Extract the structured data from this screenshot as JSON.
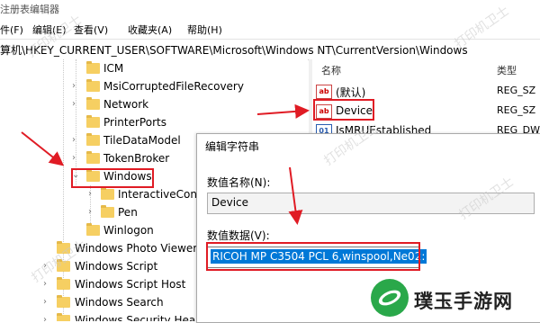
{
  "window": {
    "title": "注册表编辑器"
  },
  "menu": {
    "items": [
      "件(F)",
      "编辑(E)",
      "查看(V)",
      "收藏夹(A)",
      "帮助(H)"
    ]
  },
  "address": {
    "path": "算机\\HKEY_CURRENT_USER\\SOFTWARE\\Microsoft\\Windows NT\\CurrentVersion\\Windows"
  },
  "tree": {
    "items": [
      "ICM",
      "MsiCorruptedFileRecovery",
      "Network",
      "PrinterPorts",
      "TileDataModel",
      "TokenBroker",
      "Windows",
      "InteractiveCont",
      "Pen",
      "Winlogon",
      "Windows Photo Viewer",
      "Windows Script",
      "Windows Script Host",
      "Windows Search",
      "Windows Security Healt"
    ]
  },
  "values": {
    "headers": {
      "name": "名称",
      "type": "类型"
    },
    "rows": [
      {
        "name": "(默认)",
        "type": "REG_SZ"
      },
      {
        "name": "Device",
        "type": "REG_SZ"
      },
      {
        "name": "IsMRUEstablished",
        "type": "REG_DW"
      }
    ]
  },
  "dialog": {
    "title": "编辑字符串",
    "name_label": "数值名称(N):",
    "name_value": "Device",
    "data_label": "数值数据(V):",
    "data_value": "RICOH MP C3504 PCL 6,winspool,Ne02:"
  },
  "watermark": {
    "text": "打印机卫士"
  },
  "brand": {
    "text": "璞玉手游网"
  },
  "colors": {
    "annotation_red": "#e01b24",
    "selection_blue": "#0078d7",
    "folder_yellow": "#f6cf62"
  }
}
